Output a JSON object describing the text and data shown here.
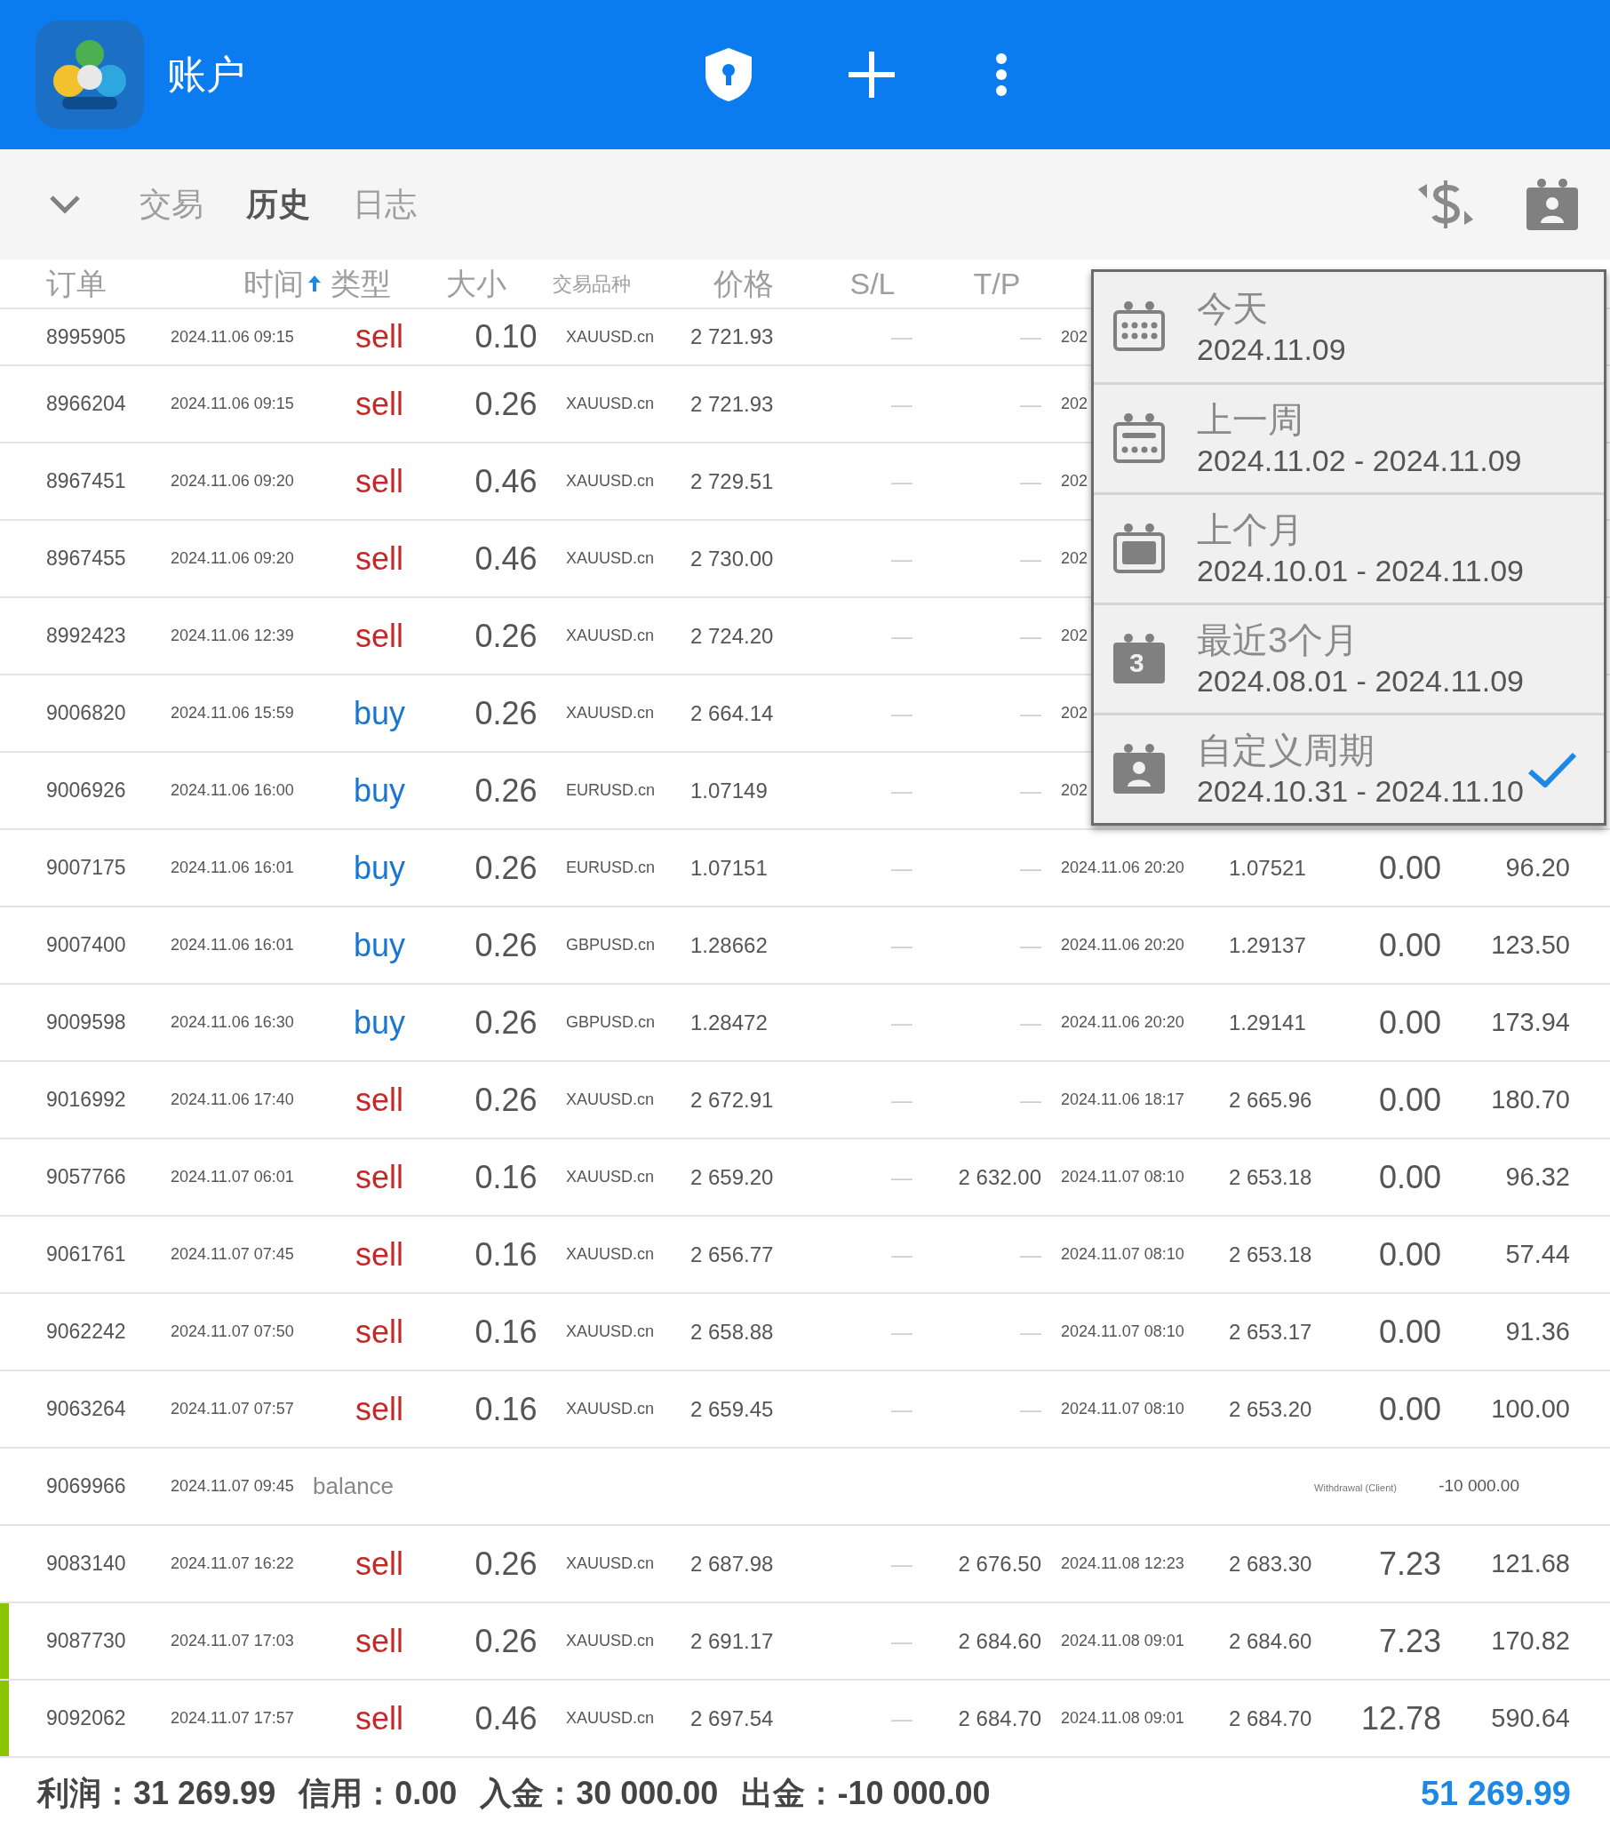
{
  "app_bar": {
    "title": "账户"
  },
  "tabs": [
    {
      "label": "交易",
      "selected": false
    },
    {
      "label": "历史",
      "selected": true
    },
    {
      "label": "日志",
      "selected": false
    }
  ],
  "columns": [
    {
      "label": "订单",
      "sorted": false
    },
    {
      "label": "时间",
      "sorted": true
    },
    {
      "label": "类型",
      "sorted": false
    },
    {
      "label": "大小",
      "sorted": false
    },
    {
      "label": "交易品种",
      "sorted": false
    },
    {
      "label": "价格",
      "sorted": false
    },
    {
      "label": "S/L",
      "sorted": false
    },
    {
      "label": "T/P",
      "sorted": false
    }
  ],
  "rows": [
    {
      "kind": "trade",
      "marked": false,
      "order": "8995905",
      "time": "2024.11.06 09:15",
      "type": "sell",
      "size": "0.10",
      "symbol": "XAUUSD.cn",
      "price": "2 721.93",
      "sl": "—",
      "tp": "—",
      "close_time": "202"
    },
    {
      "kind": "trade",
      "marked": false,
      "order": "8966204",
      "time": "2024.11.06 09:15",
      "type": "sell",
      "size": "0.26",
      "symbol": "XAUUSD.cn",
      "price": "2 721.93",
      "sl": "—",
      "tp": "—",
      "close_time": "202"
    },
    {
      "kind": "trade",
      "marked": false,
      "order": "8967451",
      "time": "2024.11.06 09:20",
      "type": "sell",
      "size": "0.46",
      "symbol": "XAUUSD.cn",
      "price": "2 729.51",
      "sl": "—",
      "tp": "—",
      "close_time": "202"
    },
    {
      "kind": "trade",
      "marked": false,
      "order": "8967455",
      "time": "2024.11.06 09:20",
      "type": "sell",
      "size": "0.46",
      "symbol": "XAUUSD.cn",
      "price": "2 730.00",
      "sl": "—",
      "tp": "—",
      "close_time": "202"
    },
    {
      "kind": "trade",
      "marked": false,
      "order": "8992423",
      "time": "2024.11.06 12:39",
      "type": "sell",
      "size": "0.26",
      "symbol": "XAUUSD.cn",
      "price": "2 724.20",
      "sl": "—",
      "tp": "—",
      "close_time": "202"
    },
    {
      "kind": "trade",
      "marked": false,
      "order": "9006820",
      "time": "2024.11.06 15:59",
      "type": "buy",
      "size": "0.26",
      "symbol": "XAUUSD.cn",
      "price": "2 664.14",
      "sl": "—",
      "tp": "—",
      "close_time": "202"
    },
    {
      "kind": "trade",
      "marked": false,
      "order": "9006926",
      "time": "2024.11.06 16:00",
      "type": "buy",
      "size": "0.26",
      "symbol": "EURUSD.cn",
      "price": "1.07149",
      "sl": "—",
      "tp": "—",
      "close_time": "202"
    },
    {
      "kind": "trade",
      "marked": false,
      "order": "9007175",
      "time": "2024.11.06 16:01",
      "type": "buy",
      "size": "0.26",
      "symbol": "EURUSD.cn",
      "price": "1.07151",
      "sl": "—",
      "tp": "—",
      "close_time": "2024.11.06 20:20",
      "close_price": "1.07521",
      "swap": "0.00",
      "profit": "96.20"
    },
    {
      "kind": "trade",
      "marked": false,
      "order": "9007400",
      "time": "2024.11.06 16:01",
      "type": "buy",
      "size": "0.26",
      "symbol": "GBPUSD.cn",
      "price": "1.28662",
      "sl": "—",
      "tp": "—",
      "close_time": "2024.11.06 20:20",
      "close_price": "1.29137",
      "swap": "0.00",
      "profit": "123.50"
    },
    {
      "kind": "trade",
      "marked": false,
      "order": "9009598",
      "time": "2024.11.06 16:30",
      "type": "buy",
      "size": "0.26",
      "symbol": "GBPUSD.cn",
      "price": "1.28472",
      "sl": "—",
      "tp": "—",
      "close_time": "2024.11.06 20:20",
      "close_price": "1.29141",
      "swap": "0.00",
      "profit": "173.94"
    },
    {
      "kind": "trade",
      "marked": false,
      "order": "9016992",
      "time": "2024.11.06 17:40",
      "type": "sell",
      "size": "0.26",
      "symbol": "XAUUSD.cn",
      "price": "2 672.91",
      "sl": "—",
      "tp": "—",
      "close_time": "2024.11.06 18:17",
      "close_price": "2 665.96",
      "swap": "0.00",
      "profit": "180.70"
    },
    {
      "kind": "trade",
      "marked": false,
      "order": "9057766",
      "time": "2024.11.07 06:01",
      "type": "sell",
      "size": "0.16",
      "symbol": "XAUUSD.cn",
      "price": "2 659.20",
      "sl": "—",
      "tp": "2 632.00",
      "close_time": "2024.11.07 08:10",
      "close_price": "2 653.18",
      "swap": "0.00",
      "profit": "96.32"
    },
    {
      "kind": "trade",
      "marked": false,
      "order": "9061761",
      "time": "2024.11.07 07:45",
      "type": "sell",
      "size": "0.16",
      "symbol": "XAUUSD.cn",
      "price": "2 656.77",
      "sl": "—",
      "tp": "—",
      "close_time": "2024.11.07 08:10",
      "close_price": "2 653.18",
      "swap": "0.00",
      "profit": "57.44"
    },
    {
      "kind": "trade",
      "marked": false,
      "order": "9062242",
      "time": "2024.11.07 07:50",
      "type": "sell",
      "size": "0.16",
      "symbol": "XAUUSD.cn",
      "price": "2 658.88",
      "sl": "—",
      "tp": "—",
      "close_time": "2024.11.07 08:10",
      "close_price": "2 653.17",
      "swap": "0.00",
      "profit": "91.36"
    },
    {
      "kind": "trade",
      "marked": false,
      "order": "9063264",
      "time": "2024.11.07 07:57",
      "type": "sell",
      "size": "0.16",
      "symbol": "XAUUSD.cn",
      "price": "2 659.45",
      "sl": "—",
      "tp": "—",
      "close_time": "2024.11.07 08:10",
      "close_price": "2 653.20",
      "swap": "0.00",
      "profit": "100.00"
    },
    {
      "kind": "balance",
      "marked": false,
      "order": "9069966",
      "time": "2024.11.07 09:45",
      "type": "balance",
      "comment": "Withdrawal (Client)",
      "profit": "-10 000.00"
    },
    {
      "kind": "trade",
      "marked": false,
      "order": "9083140",
      "time": "2024.11.07 16:22",
      "type": "sell",
      "size": "0.26",
      "symbol": "XAUUSD.cn",
      "price": "2 687.98",
      "sl": "—",
      "tp": "2 676.50",
      "close_time": "2024.11.08 12:23",
      "close_price": "2 683.30",
      "swap": "7.23",
      "profit": "121.68"
    },
    {
      "kind": "trade",
      "marked": true,
      "order": "9087730",
      "time": "2024.11.07 17:03",
      "type": "sell",
      "size": "0.26",
      "symbol": "XAUUSD.cn",
      "price": "2 691.17",
      "sl": "—",
      "tp": "2 684.60",
      "close_time": "2024.11.08 09:01",
      "close_price": "2 684.60",
      "swap": "7.23",
      "profit": "170.82"
    },
    {
      "kind": "trade",
      "marked": true,
      "order": "9092062",
      "time": "2024.11.07 17:57",
      "type": "sell",
      "size": "0.46",
      "symbol": "XAUUSD.cn",
      "price": "2 697.54",
      "sl": "—",
      "tp": "2 684.70",
      "close_time": "2024.11.08 09:01",
      "close_price": "2 684.70",
      "swap": "12.78",
      "profit": "590.64"
    }
  ],
  "period_menu": [
    {
      "kind": "today",
      "label": "今天",
      "range": "2024.11.09",
      "selected": false
    },
    {
      "kind": "week",
      "label": "上一周",
      "range": "2024.11.02 - 2024.11.09",
      "selected": false
    },
    {
      "kind": "month",
      "label": "上个月",
      "range": "2024.10.01 - 2024.11.09",
      "selected": false
    },
    {
      "kind": "three_months",
      "label": "最近3个月",
      "range": "2024.08.01 - 2024.11.09",
      "selected": false,
      "badge": "3"
    },
    {
      "kind": "custom",
      "label": "自定义周期",
      "range": "2024.10.31 - 2024.11.10",
      "selected": true
    }
  ],
  "summary": [
    {
      "label": "利润：",
      "value": "31 269.99"
    },
    {
      "label": "信用：",
      "value": "0.00"
    },
    {
      "label": "入金：",
      "value": "30 000.00"
    },
    {
      "label": "出金：",
      "value": "-10 000.00"
    }
  ],
  "balance_total": "51 269.99"
}
